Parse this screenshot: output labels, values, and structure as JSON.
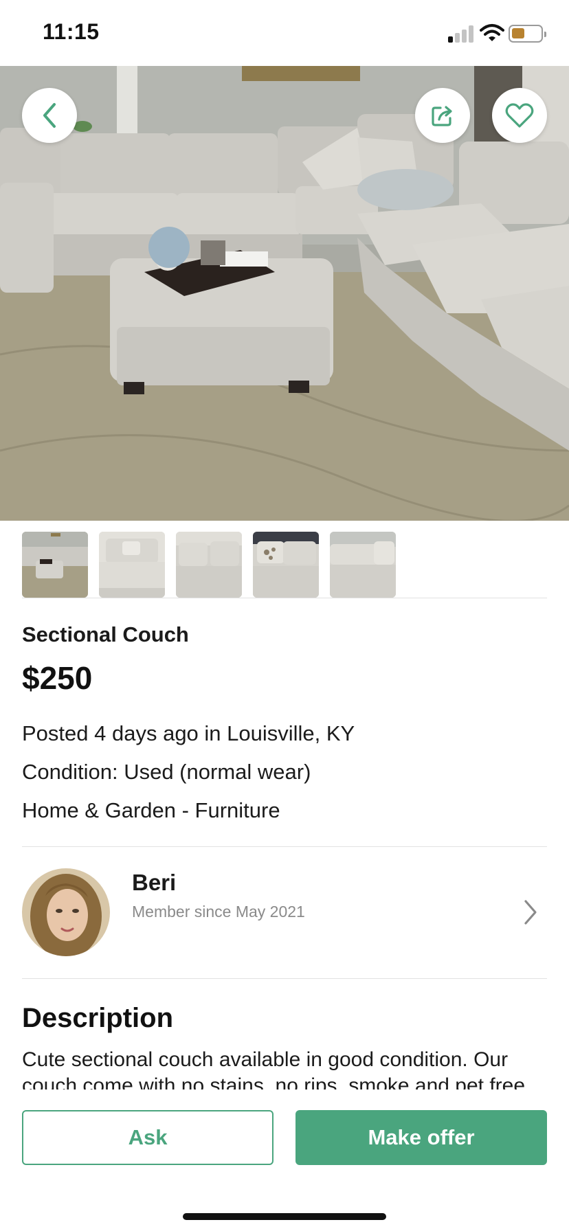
{
  "status_bar": {
    "time": "11:15"
  },
  "colors": {
    "accent": "#4aa57e",
    "muted_text": "#8a8a8a",
    "divider": "#e1e1e1"
  },
  "hero": {
    "photo": "sectional-couch-photo",
    "icons": [
      "chevron-left-icon",
      "share-icon",
      "heart-icon"
    ]
  },
  "thumbnails": [
    "thumbnail-1",
    "thumbnail-2",
    "thumbnail-3",
    "thumbnail-4",
    "thumbnail-5"
  ],
  "listing": {
    "title": "Sectional Couch",
    "price": "$250",
    "posted": "Posted 4 days ago in Louisville, KY",
    "condition": "Condition: Used (normal wear)",
    "category": "Home & Garden - Furniture"
  },
  "seller": {
    "name": "Beri",
    "member_since": "Member since May 2021"
  },
  "description": {
    "heading": "Description",
    "body": "Cute sectional couch available in good condition. Our couch come with no stains, no rips, smoke and pet free"
  },
  "actions": {
    "ask_label": "Ask",
    "offer_label": "Make offer"
  }
}
